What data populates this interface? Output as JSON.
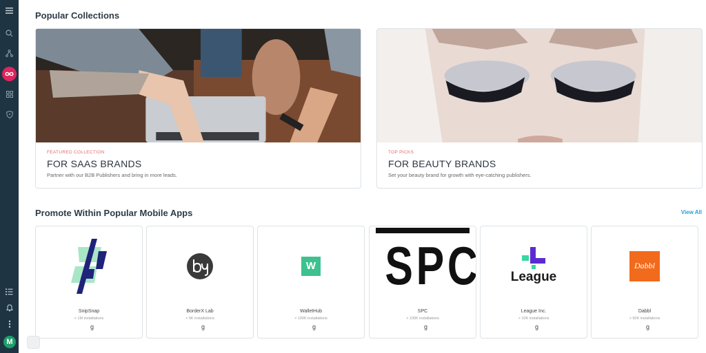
{
  "sidebar": {
    "icons": [
      "menu-icon",
      "search-icon",
      "network-icon",
      "infinity-icon",
      "grid-icon",
      "shield-icon",
      "checklist-icon",
      "bell-icon",
      "more-icon"
    ],
    "avatar_initial": "M"
  },
  "sections": {
    "collections_title": "Popular Collections",
    "apps_title": "Promote Within Popular Mobile Apps",
    "view_all": "View All"
  },
  "collections": [
    {
      "eyebrow": "FEATURED COLLECTION",
      "title": "FOR SAAS BRANDS",
      "subtitle": "Partner with our B2B Publishers and bring in more leads.",
      "eyebrow_color": "#e06a6a"
    },
    {
      "eyebrow": "TOP PICKS",
      "title": "FOR BEAUTY BRANDS",
      "subtitle": "Set your beauty brand for growth with eye-catching publishers.",
      "eyebrow_color": "#e06a6a"
    }
  ],
  "apps": [
    {
      "name": "SnipSnap",
      "installs": "> 1M installations",
      "logo": "snipsnap-logo"
    },
    {
      "name": "BorderX Lab",
      "installs": "> 5K installations",
      "logo": "borderx-logo",
      "logo_text": "bx"
    },
    {
      "name": "WalletHub",
      "installs": "> 100K installations",
      "logo": "wallethub-logo",
      "logo_text": "W"
    },
    {
      "name": "SPC",
      "installs": "> 100K installations",
      "logo": "spc-logo",
      "logo_text": "SPC"
    },
    {
      "name": "League Inc.",
      "installs": "> 10K installations",
      "logo": "league-logo",
      "logo_text": "League"
    },
    {
      "name": "Dabbl",
      "installs": "> 50K installations",
      "logo": "dabbl-logo",
      "logo_text": "Dabbl"
    }
  ],
  "platform_glyphs": {
    "apple": "",
    "google": "g"
  },
  "colors": {
    "sidebar": "#1f3442",
    "active": "#e0245e",
    "accent": "#2a9fd8",
    "wallethub": "#3cc18f",
    "dabbl": "#f26a1b",
    "league_purple": "#5b2bd1",
    "league_green": "#3ad6a3"
  }
}
